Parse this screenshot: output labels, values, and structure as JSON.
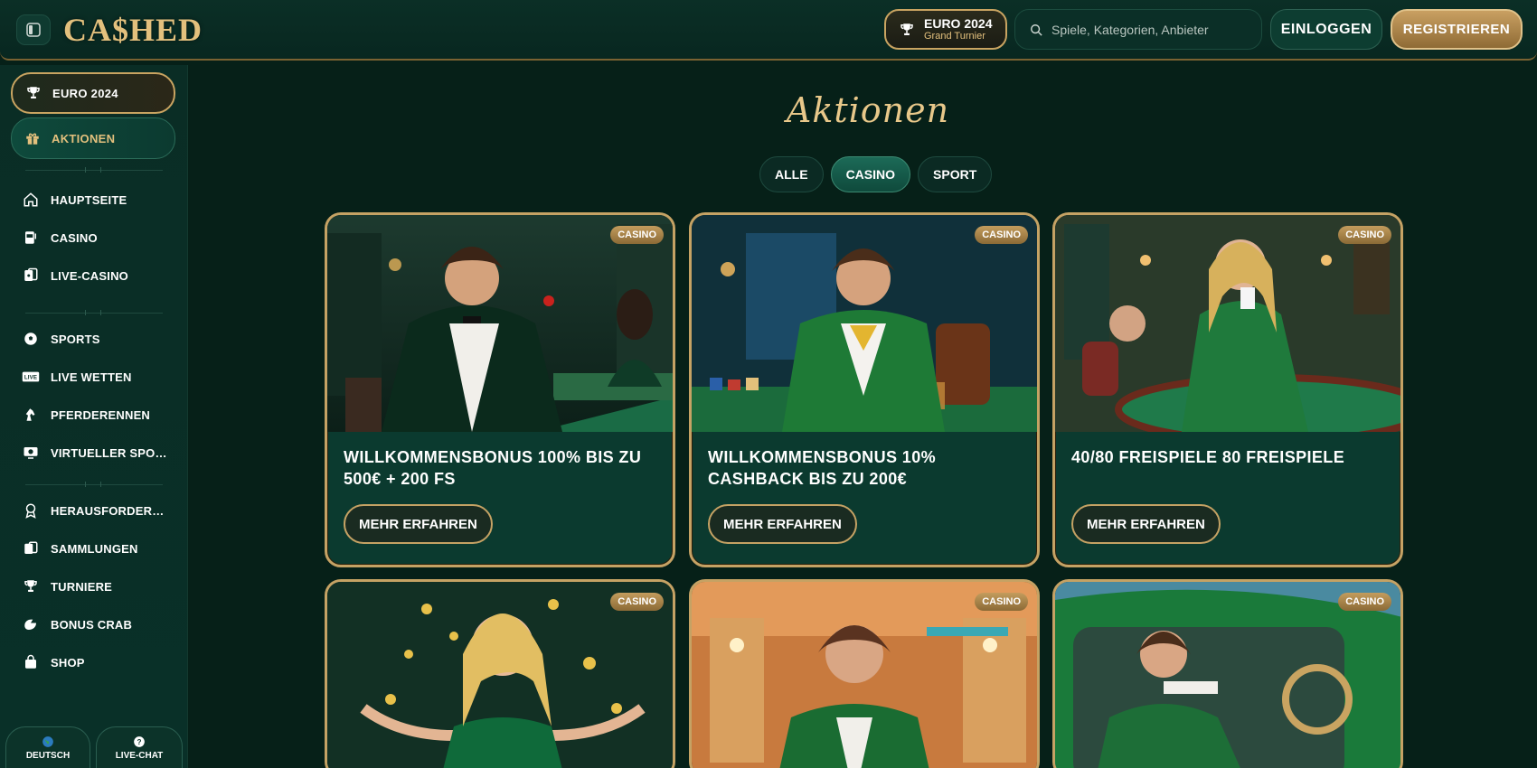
{
  "header": {
    "logo": "CA$HED",
    "euro_title": "EURO 2024",
    "euro_sub": "Grand Turnier",
    "search_placeholder": "Spiele, Kategorien, Anbieter",
    "login": "EINLOGGEN",
    "register": "REGISTRIEREN"
  },
  "sidebar": {
    "euro": "EURO 2024",
    "aktionen": "AKTIONEN",
    "group1": [
      "HAUPTSEITE",
      "CASINO",
      "LIVE-CASINO"
    ],
    "group2": [
      "SPORTS",
      "LIVE WETTEN",
      "PFERDERENNEN",
      "VIRTUELLER SPORT"
    ],
    "group3": [
      "HERAUSFORDERUN...",
      "SAMMLUNGEN",
      "TURNIERE",
      "BONUS CRAB",
      "SHOP"
    ],
    "language": "DEUTSCH",
    "chat": "LIVE-CHAT"
  },
  "main": {
    "title": "Aktionen",
    "filters": [
      "ALLE",
      "CASINO",
      "SPORT"
    ],
    "active_filter": "CASINO",
    "cards": [
      {
        "badge": "CASINO",
        "title": "WILLKOMMENSBONUS 100% BIS ZU 500€ + 200 FS",
        "button": "MEHR ERFAHREN"
      },
      {
        "badge": "CASINO",
        "title": "WILLKOMMENSBONUS 10% CASHBACK BIS ZU 200€",
        "button": "MEHR ERFAHREN"
      },
      {
        "badge": "CASINO",
        "title": "40/80 FREISPIELE 80 FREISPIELE",
        "button": "MEHR ERFAHREN"
      },
      {
        "badge": "CASINO"
      },
      {
        "badge": "CASINO"
      },
      {
        "badge": "CASINO"
      }
    ]
  },
  "colors": {
    "gold": "#c5a264",
    "bg": "#062018",
    "card": "#0b3a2f",
    "accent_green": "#1c6a57"
  }
}
